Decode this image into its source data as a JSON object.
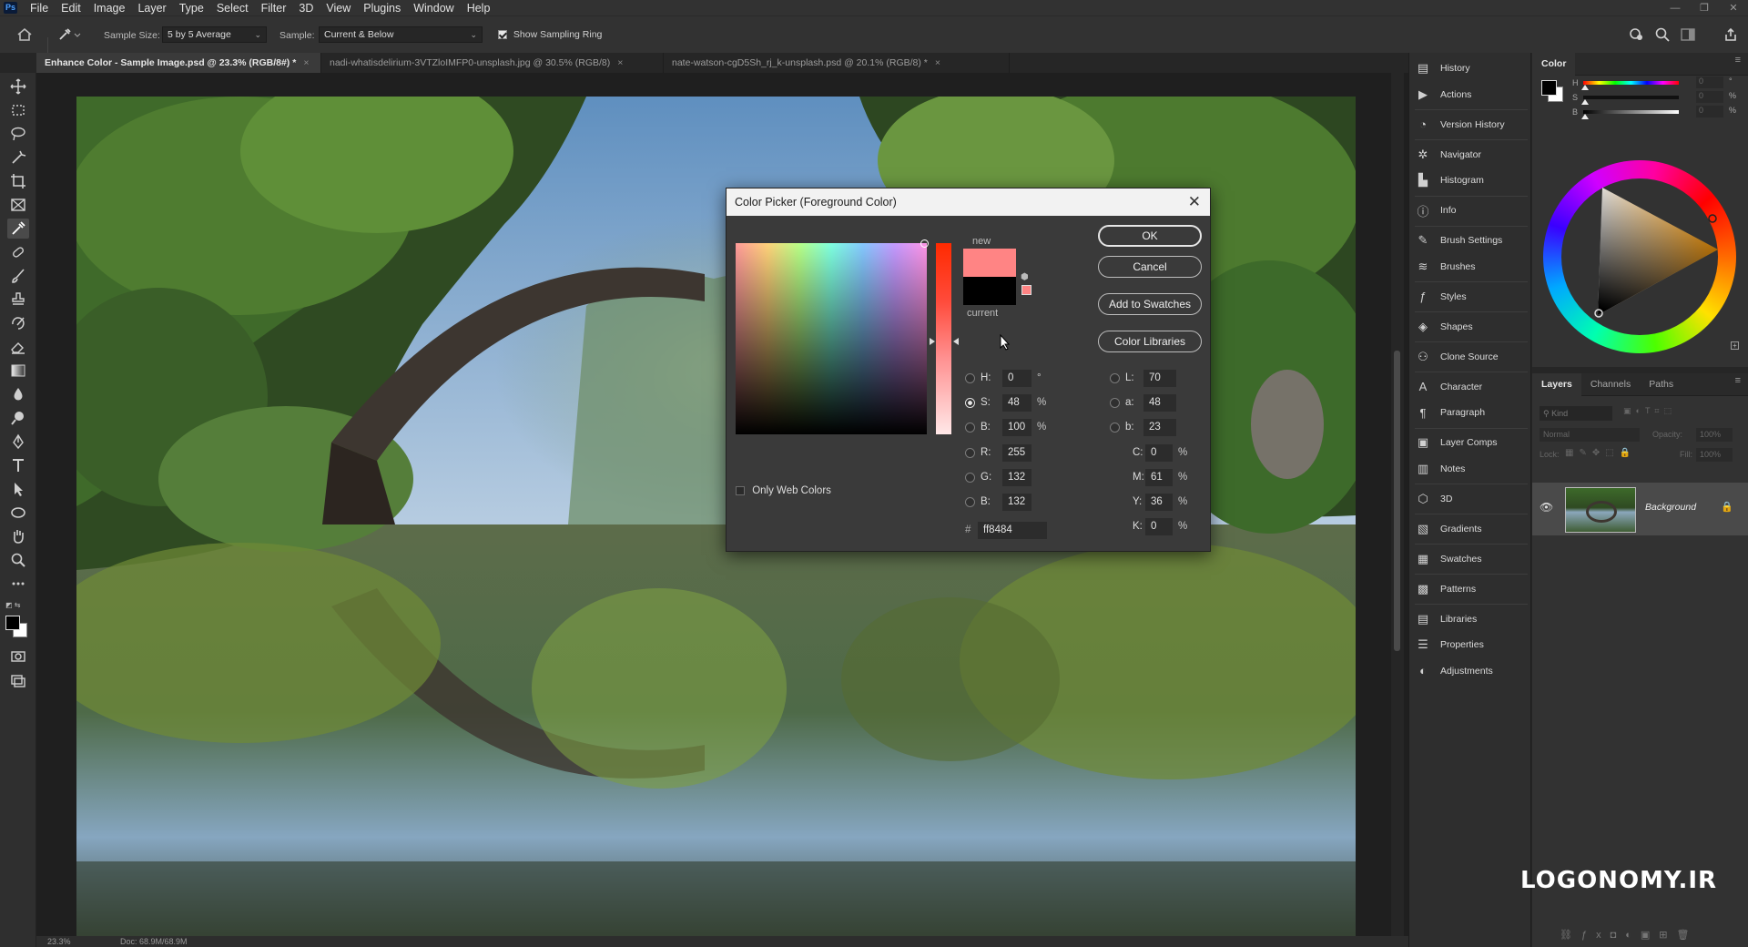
{
  "app": {
    "logo_text": "Ps",
    "menu": [
      "File",
      "Edit",
      "Image",
      "Layer",
      "Type",
      "Select",
      "Filter",
      "3D",
      "View",
      "Plugins",
      "Window",
      "Help"
    ]
  },
  "options_bar": {
    "sample_size_label": "Sample Size:",
    "sample_size_value": "5 by 5 Average",
    "sample_label": "Sample:",
    "sample_value": "Current & Below",
    "show_sampling_ring_label": "Show Sampling Ring",
    "show_sampling_ring_checked": true
  },
  "tabs": [
    {
      "label": "Enhance Color - Sample Image.psd @ 23.3% (RGB/8#) *",
      "active": true
    },
    {
      "label": "nadi-whatisdelirium-3VTZloIMFP0-unsplash.jpg @ 30.5% (RGB/8)",
      "active": false
    },
    {
      "label": "nate-watson-cgD5Sh_rj_k-unsplash.psd @ 20.1% (RGB/8) *",
      "active": false
    }
  ],
  "status": {
    "zoom": "23.3%",
    "doc": "Doc: 68.9M/68.9M"
  },
  "panel_list": [
    {
      "label": "History",
      "icon": "history-icon",
      "glyph": "▤"
    },
    {
      "label": "Actions",
      "icon": "actions-icon",
      "glyph": "▶"
    },
    {
      "label": "Version History",
      "icon": "version-history-icon",
      "glyph": "◔"
    },
    {
      "label": "Navigator",
      "icon": "navigator-icon",
      "glyph": "✲"
    },
    {
      "label": "Histogram",
      "icon": "histogram-icon",
      "glyph": "▙"
    },
    {
      "label": "Info",
      "icon": "info-icon",
      "glyph": "ⓘ"
    },
    {
      "label": "Brush Settings",
      "icon": "brush-settings-icon",
      "glyph": "✎"
    },
    {
      "label": "Brushes",
      "icon": "brushes-icon",
      "glyph": "≋"
    },
    {
      "label": "Styles",
      "icon": "styles-icon",
      "glyph": "ƒ"
    },
    {
      "label": "Shapes",
      "icon": "shapes-icon",
      "glyph": "◈"
    },
    {
      "label": "Clone Source",
      "icon": "clone-source-icon",
      "glyph": "⚇"
    },
    {
      "label": "Character",
      "icon": "character-icon",
      "glyph": "A"
    },
    {
      "label": "Paragraph",
      "icon": "paragraph-icon",
      "glyph": "¶"
    },
    {
      "label": "Layer Comps",
      "icon": "layer-comps-icon",
      "glyph": "▣"
    },
    {
      "label": "Notes",
      "icon": "notes-icon",
      "glyph": "▥"
    },
    {
      "label": "3D",
      "icon": "3d-icon",
      "glyph": "⬡"
    },
    {
      "label": "Gradients",
      "icon": "gradients-icon",
      "glyph": "▧"
    },
    {
      "label": "Swatches",
      "icon": "swatches-icon",
      "glyph": "▦"
    },
    {
      "label": "Patterns",
      "icon": "patterns-icon",
      "glyph": "▩"
    },
    {
      "label": "Libraries",
      "icon": "libraries-icon",
      "glyph": "▤"
    },
    {
      "label": "Properties",
      "icon": "properties-icon",
      "glyph": "☰"
    },
    {
      "label": "Adjustments",
      "icon": "adjustments-icon",
      "glyph": "◐"
    }
  ],
  "color_panel": {
    "title": "Color",
    "slider_labels": [
      "H",
      "S",
      "B"
    ],
    "slider_values": [
      "0",
      "0",
      "0"
    ],
    "slider_units": [
      "°",
      "%",
      "%"
    ],
    "foreground_color": "#000000",
    "background_color": "#ffffff"
  },
  "layers_panel": {
    "tabs": [
      "Layers",
      "Channels",
      "Paths"
    ],
    "kind_placeholder": "Kind",
    "blend_mode": "Normal",
    "opacity_label": "Opacity:",
    "opacity_value": "100%",
    "lock_label": "Lock:",
    "fill_label": "Fill:",
    "fill_value": "100%",
    "layers": [
      {
        "name": "Background",
        "visible": true,
        "locked": true
      }
    ]
  },
  "color_picker": {
    "title": "Color Picker (Foreground Color)",
    "new_label": "new",
    "current_label": "current",
    "new_color": "#ff8484",
    "current_color": "#000000",
    "buttons": {
      "ok": "OK",
      "cancel": "Cancel",
      "add_to_swatches": "Add to Swatches",
      "color_libraries": "Color Libraries"
    },
    "only_web_colors": "Only Web Colors",
    "hsb": [
      {
        "label": "H:",
        "value": "0",
        "unit": "°",
        "selected": false
      },
      {
        "label": "S:",
        "value": "48",
        "unit": "%",
        "selected": true
      },
      {
        "label": "B:",
        "value": "100",
        "unit": "%",
        "selected": false
      }
    ],
    "rgb": [
      {
        "label": "R:",
        "value": "255"
      },
      {
        "label": "G:",
        "value": "132"
      },
      {
        "label": "B:",
        "value": "132"
      }
    ],
    "lab": [
      {
        "label": "L:",
        "value": "70"
      },
      {
        "label": "a:",
        "value": "48"
      },
      {
        "label": "b:",
        "value": "23"
      }
    ],
    "cmyk": [
      {
        "label": "C:",
        "value": "0",
        "unit": "%"
      },
      {
        "label": "M:",
        "value": "61",
        "unit": "%"
      },
      {
        "label": "Y:",
        "value": "36",
        "unit": "%"
      },
      {
        "label": "K:",
        "value": "0",
        "unit": "%"
      }
    ],
    "hex_label": "#",
    "hex_value": "ff8484"
  },
  "watermark": "LOGONOMY.IR"
}
